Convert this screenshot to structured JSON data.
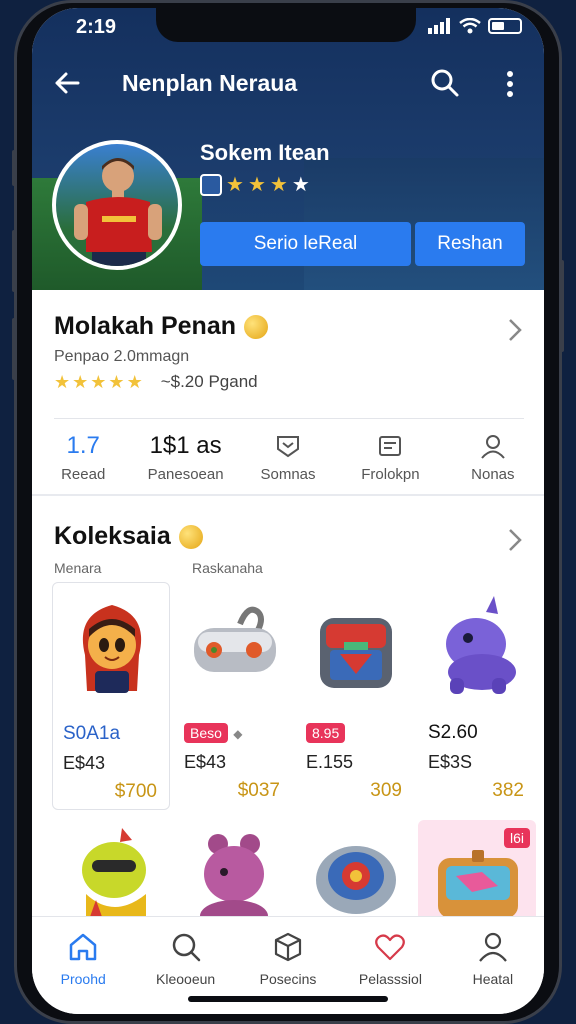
{
  "status_bar": {
    "time": "2:19"
  },
  "topbar": {
    "title": "Nenplan Neraua"
  },
  "store": {
    "name": "Sokem Itean",
    "primary_button": "Serio leReal",
    "secondary_button": "Reshan"
  },
  "info": {
    "title": "Molakah Penan",
    "subtitle": "Penpao 2.0mmagn",
    "price": "~$.20 Pgand",
    "stats": [
      {
        "value": "1.7",
        "label": "Reead",
        "icon": ""
      },
      {
        "value": "1$1 as",
        "label": "Panesoean",
        "icon": ""
      },
      {
        "value": "",
        "label": "Somnas",
        "icon": "shield-message-icon"
      },
      {
        "value": "",
        "label": "Frolokpn",
        "icon": "document-icon"
      },
      {
        "value": "",
        "label": "Nonas",
        "icon": "user-icon"
      }
    ]
  },
  "collection": {
    "title": "Koleksaia",
    "sub_left": "Menara",
    "sub_right": "Raskanaha",
    "items": [
      {
        "icon": "character-girl-icon",
        "price": "S0A1a",
        "old": "E$43",
        "sale": "$700",
        "tag": ""
      },
      {
        "icon": "gadget-device-icon",
        "price": "",
        "old": "E$43",
        "sale": "$037",
        "tag": "Beso"
      },
      {
        "icon": "chest-box-icon",
        "price": "",
        "old": "E.155",
        "sale": "309",
        "tag": "8.95"
      },
      {
        "icon": "purple-creature-icon",
        "price": "S2.60",
        "old": "E$3S",
        "sale": "382",
        "tag": ""
      },
      {
        "icon": "yellow-monster-icon",
        "tag": ""
      },
      {
        "icon": "pink-creature-icon",
        "tag": ""
      },
      {
        "icon": "orb-device-icon",
        "tag": ""
      },
      {
        "icon": "treasure-case-icon",
        "tag": "l6i"
      }
    ]
  },
  "tabs": [
    {
      "label": "Proohd",
      "icon": "home-icon",
      "active": true
    },
    {
      "label": "Kleooeun",
      "icon": "search-icon",
      "active": false
    },
    {
      "label": "Posecins",
      "icon": "box-icon",
      "active": false
    },
    {
      "label": "Pelasssiol",
      "icon": "heart-icon",
      "active": false
    },
    {
      "label": "Heatal",
      "icon": "user-icon",
      "active": false
    }
  ],
  "colors": {
    "accent": "#2a7bef",
    "header": "#14305e",
    "sale": "#c89516",
    "tag": "#e8345a"
  }
}
